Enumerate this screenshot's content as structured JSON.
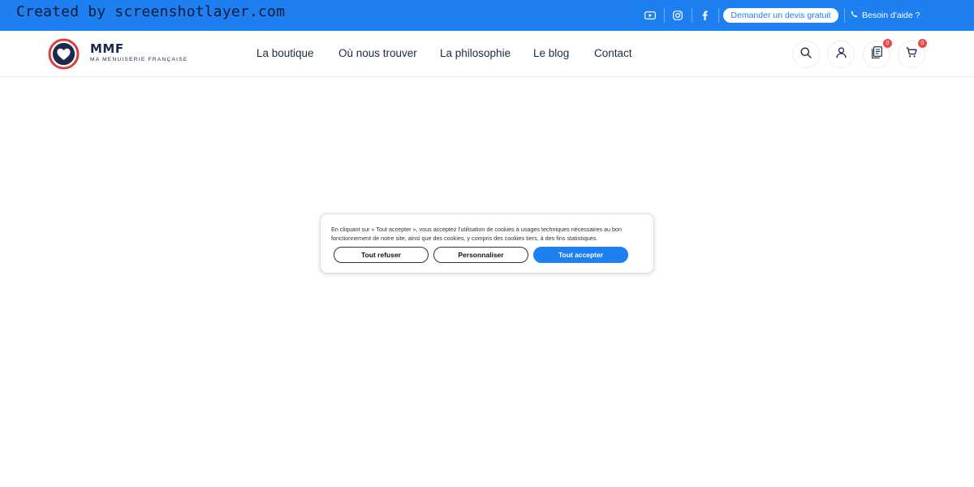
{
  "watermark": "Created by screenshotlayer.com",
  "topbar": {
    "social": [
      {
        "icon": "youtube-icon"
      },
      {
        "icon": "instagram-icon"
      },
      {
        "icon": "facebook-icon"
      }
    ],
    "quote_label": "Demander un devis gratuit",
    "help_label": "Besoin d'aide ?",
    "help_icon": "phone-icon"
  },
  "header": {
    "logo": {
      "title": "MMF",
      "subtitle": "MA MENUISERIE FRANÇAISE",
      "icon": "heart-logo-icon"
    },
    "nav": [
      {
        "label": "La boutique"
      },
      {
        "label": "Où nous trouver"
      },
      {
        "label": "La philosophie"
      },
      {
        "label": "Le blog"
      },
      {
        "label": "Contact"
      }
    ],
    "actions": {
      "search_icon": "search-icon",
      "account_icon": "user-icon",
      "quote_icon": "quote-list-icon",
      "quote_count": "0",
      "cart_icon": "cart-icon",
      "cart_count": "0"
    }
  },
  "cookie": {
    "text": "En cliquant sur « Tout accepter », vous acceptez l'utilisation de cookies à usages techniques nécessaires au bon fonctionnement de notre site, ainsi que des cookies, y compris des cookies tiers, à des fins statistiques.",
    "refuse_label": "Tout refuser",
    "customize_label": "Personnaliser",
    "accept_label": "Tout accepter"
  },
  "colors": {
    "brand_blue": "#1e7ff0",
    "navy": "#1b2a4a",
    "logo_red": "#d9403a",
    "badge_red": "#e84a4a"
  }
}
